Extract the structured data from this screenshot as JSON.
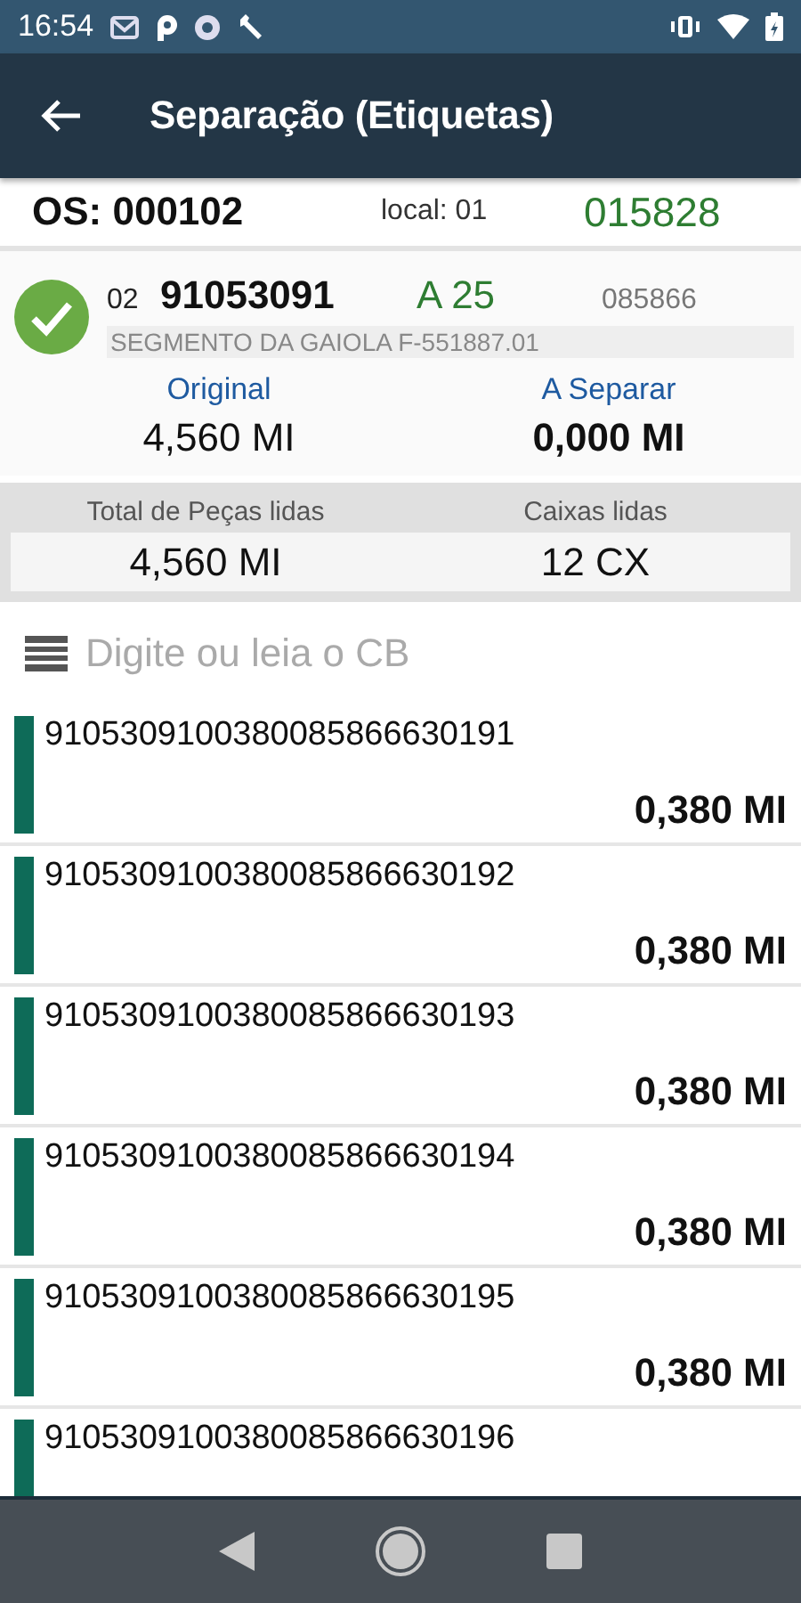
{
  "status_bar": {
    "time": "16:54"
  },
  "app_bar": {
    "title": "Separação (Etiquetas)"
  },
  "order": {
    "os": "OS: 000102",
    "local": "local: 01",
    "code": "015828"
  },
  "item": {
    "seq": "02",
    "number": "91053091",
    "location": "A 25",
    "ref": "085866",
    "description": "SEGMENTO DA GAIOLA F-551887.01",
    "original_label": "Original",
    "original_value": "4,560 MI",
    "pending_label": "A Separar",
    "pending_value": "0,000 MI"
  },
  "totals": {
    "pieces_label": "Total de Peças lidas",
    "pieces_value": "4,560 MI",
    "boxes_label": "Caixas lidas",
    "boxes_value": "12 CX"
  },
  "scan_field": {
    "placeholder": "Digite ou leia o CB"
  },
  "labels": [
    {
      "code": "9105309100380085866630191",
      "quantity": "0,380 MI"
    },
    {
      "code": "9105309100380085866630192",
      "quantity": "0,380 MI"
    },
    {
      "code": "9105309100380085866630193",
      "quantity": "0,380 MI"
    },
    {
      "code": "9105309100380085866630194",
      "quantity": "0,380 MI"
    },
    {
      "code": "9105309100380085866630195",
      "quantity": "0,380 MI"
    },
    {
      "code": "9105309100380085866630196"
    }
  ]
}
